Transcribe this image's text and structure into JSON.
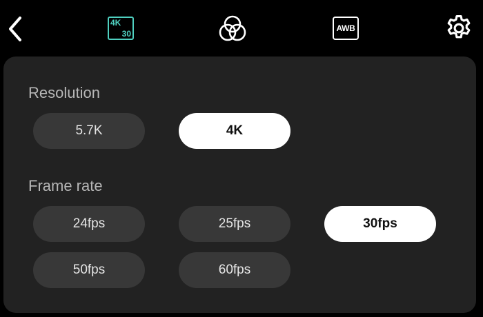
{
  "topbar": {
    "back_icon": "chevron-left-icon",
    "resolution_badge": {
      "top": "4K",
      "bottom": "30",
      "color": "#4fd0c0"
    },
    "color_icon": "color-circles-icon",
    "awb_label": "AWB",
    "settings_icon": "gear-icon"
  },
  "resolution": {
    "label": "Resolution",
    "options": [
      "5.7K",
      "4K"
    ],
    "selected": "4K"
  },
  "frame_rate": {
    "label": "Frame rate",
    "options": [
      "24fps",
      "25fps",
      "30fps",
      "50fps",
      "60fps"
    ],
    "selected": "30fps"
  },
  "colors": {
    "background": "#000000",
    "panel": "#222222",
    "pill": "#383838",
    "pill_selected": "#ffffff",
    "accent": "#4fd0c0"
  }
}
